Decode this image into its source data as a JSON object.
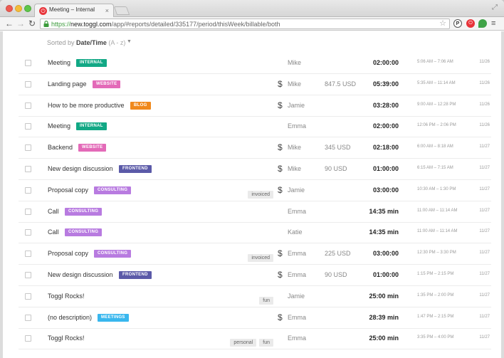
{
  "browser": {
    "tab_title": "Meeting – Internal",
    "tab_favicon": "toggl-power-icon",
    "url_scheme": "https://",
    "url_host": "new.toggl.com",
    "url_path": "/app/#reports/detailed/335177/period/thisWeek/billable/both",
    "extensions": [
      "P",
      "⏻",
      ""
    ]
  },
  "sort": {
    "prefix": "Sorted by",
    "field": "Date/Time",
    "direction": "(A - z)"
  },
  "colors": {
    "internal": "#12a885",
    "website": "#e36ab8",
    "blog": "#f0891c",
    "frontend": "#5b5aa8",
    "consulting": "#b87be0",
    "meetings": "#39b7ee"
  },
  "rows": [
    {
      "description": "Meeting",
      "project": "INTERNAL",
      "project_color": "#12a885",
      "tags": [],
      "billable": false,
      "user": "Mike",
      "amount": "",
      "duration": "02:00:00",
      "time_range": "5:06 AM – 7:06 AM",
      "date": "11/26"
    },
    {
      "description": "Landing page",
      "project": "WEBSITE",
      "project_color": "#e36ab8",
      "tags": [],
      "billable": true,
      "user": "Mike",
      "amount": "847.5 USD",
      "duration": "05:39:00",
      "time_range": "5:35 AM – 11:14 AM",
      "date": "11/26"
    },
    {
      "description": "How to be more productive",
      "project": "BLOG",
      "project_color": "#f0891c",
      "tags": [],
      "billable": true,
      "user": "Jamie",
      "amount": "",
      "duration": "03:28:00",
      "time_range": "9:00 AM – 12:28 PM",
      "date": "11/26"
    },
    {
      "description": "Meeting",
      "project": "INTERNAL",
      "project_color": "#12a885",
      "tags": [],
      "billable": false,
      "user": "Emma",
      "amount": "",
      "duration": "02:00:00",
      "time_range": "12:06 PM – 2:06 PM",
      "date": "11/26"
    },
    {
      "description": "Backend",
      "project": "WEBSITE",
      "project_color": "#e36ab8",
      "tags": [],
      "billable": true,
      "user": "Mike",
      "amount": "345 USD",
      "duration": "02:18:00",
      "time_range": "6:00 AM – 8:18 AM",
      "date": "11/27"
    },
    {
      "description": "New design discussion",
      "project": "FRONTEND",
      "project_color": "#5b5aa8",
      "tags": [],
      "billable": true,
      "user": "Mike",
      "amount": "90 USD",
      "duration": "01:00:00",
      "time_range": "6:15 AM – 7:15 AM",
      "date": "11/27"
    },
    {
      "description": "Proposal copy",
      "project": "CONSULTING",
      "project_color": "#b87be0",
      "tags": [
        "invoiced"
      ],
      "billable": true,
      "user": "Jamie",
      "amount": "",
      "duration": "03:00:00",
      "time_range": "10:30 AM – 1:30 PM",
      "date": "11/27"
    },
    {
      "description": "Call",
      "project": "CONSULTING",
      "project_color": "#b87be0",
      "tags": [],
      "billable": false,
      "user": "Emma",
      "amount": "",
      "duration": "14:35 min",
      "time_range": "11:00 AM – 11:14 AM",
      "date": "11/27"
    },
    {
      "description": "Call",
      "project": "CONSULTING",
      "project_color": "#b87be0",
      "tags": [],
      "billable": false,
      "user": "Katie",
      "amount": "",
      "duration": "14:35 min",
      "time_range": "11:00 AM – 11:14 AM",
      "date": "11/27"
    },
    {
      "description": "Proposal copy",
      "project": "CONSULTING",
      "project_color": "#b87be0",
      "tags": [
        "invoiced"
      ],
      "billable": true,
      "user": "Emma",
      "amount": "225 USD",
      "duration": "03:00:00",
      "time_range": "12:30 PM – 3:30 PM",
      "date": "11/27"
    },
    {
      "description": "New design discussion",
      "project": "FRONTEND",
      "project_color": "#5b5aa8",
      "tags": [],
      "billable": true,
      "user": "Emma",
      "amount": "90 USD",
      "duration": "01:00:00",
      "time_range": "1:15 PM – 2:15 PM",
      "date": "11/27"
    },
    {
      "description": "Toggl Rocks!",
      "project": "",
      "project_color": "",
      "tags": [
        "fun"
      ],
      "billable": false,
      "user": "Jamie",
      "amount": "",
      "duration": "25:00 min",
      "time_range": "1:35 PM – 2:00 PM",
      "date": "11/27"
    },
    {
      "description": "(no description)",
      "project": "MEETINGS",
      "project_color": "#39b7ee",
      "tags": [],
      "billable": true,
      "user": "Emma",
      "amount": "",
      "duration": "28:39 min",
      "time_range": "1:47 PM – 2:15 PM",
      "date": "11/27"
    },
    {
      "description": "Toggl Rocks!",
      "project": "",
      "project_color": "",
      "tags": [
        "personal",
        "fun"
      ],
      "billable": false,
      "user": "Emma",
      "amount": "",
      "duration": "25:00 min",
      "time_range": "3:35 PM – 4:00 PM",
      "date": "11/27"
    }
  ]
}
